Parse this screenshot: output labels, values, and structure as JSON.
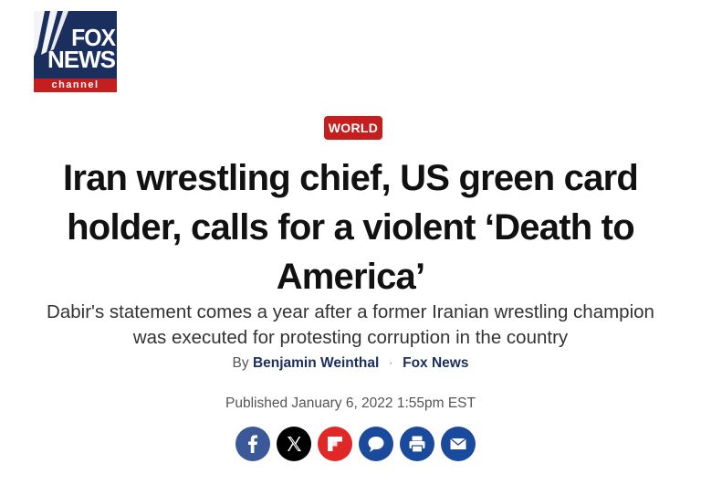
{
  "logo": {
    "line1": "FOX",
    "line2": "NEWS",
    "line3": "channel",
    "colors": {
      "navy": "#1a2f5e",
      "red": "#c41e1e"
    }
  },
  "article": {
    "category": "WORLD",
    "headline": "Iran wrestling chief, US green card holder, calls for a violent ‘Death to America’",
    "subheadline": "Dabir's statement comes a year after a former Iranian wrestling champion was executed for protesting corruption in the country",
    "byline_prefix": "By",
    "author": "Benjamin Weinthal",
    "separator": "·",
    "outlet": "Fox News",
    "published": "Published January 6, 2022 1:55pm EST"
  },
  "share": {
    "buttons": [
      {
        "icon": "facebook-icon",
        "color": "#3b5998"
      },
      {
        "icon": "x-twitter-icon",
        "color": "#000000"
      },
      {
        "icon": "flipboard-icon",
        "color": "#e12828"
      },
      {
        "icon": "comments-icon",
        "color": "#1a4a9c"
      },
      {
        "icon": "print-icon",
        "color": "#1a4a9c"
      },
      {
        "icon": "email-icon",
        "color": "#1a4a9c"
      }
    ]
  }
}
